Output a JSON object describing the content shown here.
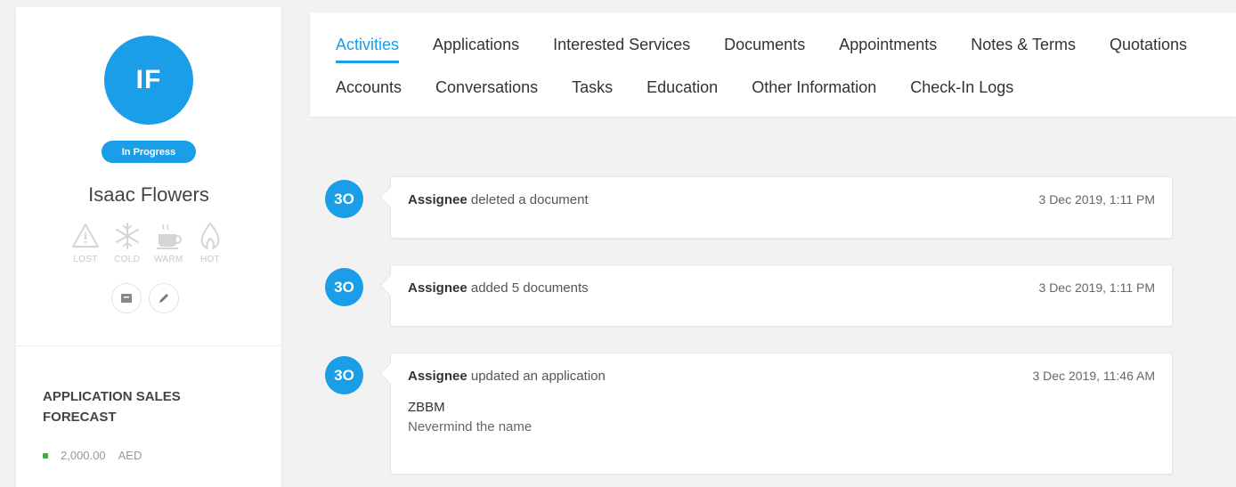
{
  "profile": {
    "initials": "IF",
    "status": "In Progress",
    "name": "Isaac Flowers",
    "temperatures": [
      {
        "label": "LOST",
        "icon": "warning-icon"
      },
      {
        "label": "COLD",
        "icon": "snowflake-icon"
      },
      {
        "label": "WARM",
        "icon": "coffee-cup-icon"
      },
      {
        "label": "HOT",
        "icon": "flame-icon"
      }
    ],
    "actions": [
      {
        "icon": "archive-icon"
      },
      {
        "icon": "edit-icon"
      }
    ]
  },
  "forecast": {
    "title": "APPLICATION SALES FORECAST",
    "amount": "2,000.00",
    "currency": "AED"
  },
  "tabs": {
    "row1": [
      {
        "label": "Activities",
        "active": true
      },
      {
        "label": "Applications"
      },
      {
        "label": "Interested Services"
      },
      {
        "label": "Documents"
      },
      {
        "label": "Appointments"
      },
      {
        "label": "Notes & Terms"
      },
      {
        "label": "Quotations"
      }
    ],
    "row2": [
      {
        "label": "Accounts"
      },
      {
        "label": "Conversations"
      },
      {
        "label": "Tasks"
      },
      {
        "label": "Education"
      },
      {
        "label": "Other Information"
      },
      {
        "label": "Check-In Logs"
      }
    ]
  },
  "activities": [
    {
      "avatar": "3O",
      "actor": "Assignee",
      "action": "deleted a document",
      "time": "3 Dec 2019, 1:11 PM"
    },
    {
      "avatar": "3O",
      "actor": "Assignee",
      "action": "added 5 documents",
      "time": "3 Dec 2019, 1:11 PM"
    },
    {
      "avatar": "3O",
      "actor": "Assignee",
      "action": "updated an application",
      "time": "3 Dec 2019, 11:46 AM",
      "detail_title": "ZBBM",
      "detail_body": "Nevermind the name"
    }
  ],
  "colors": {
    "accent": "#1a9ee8",
    "forecast_dot": "#3cb043"
  }
}
